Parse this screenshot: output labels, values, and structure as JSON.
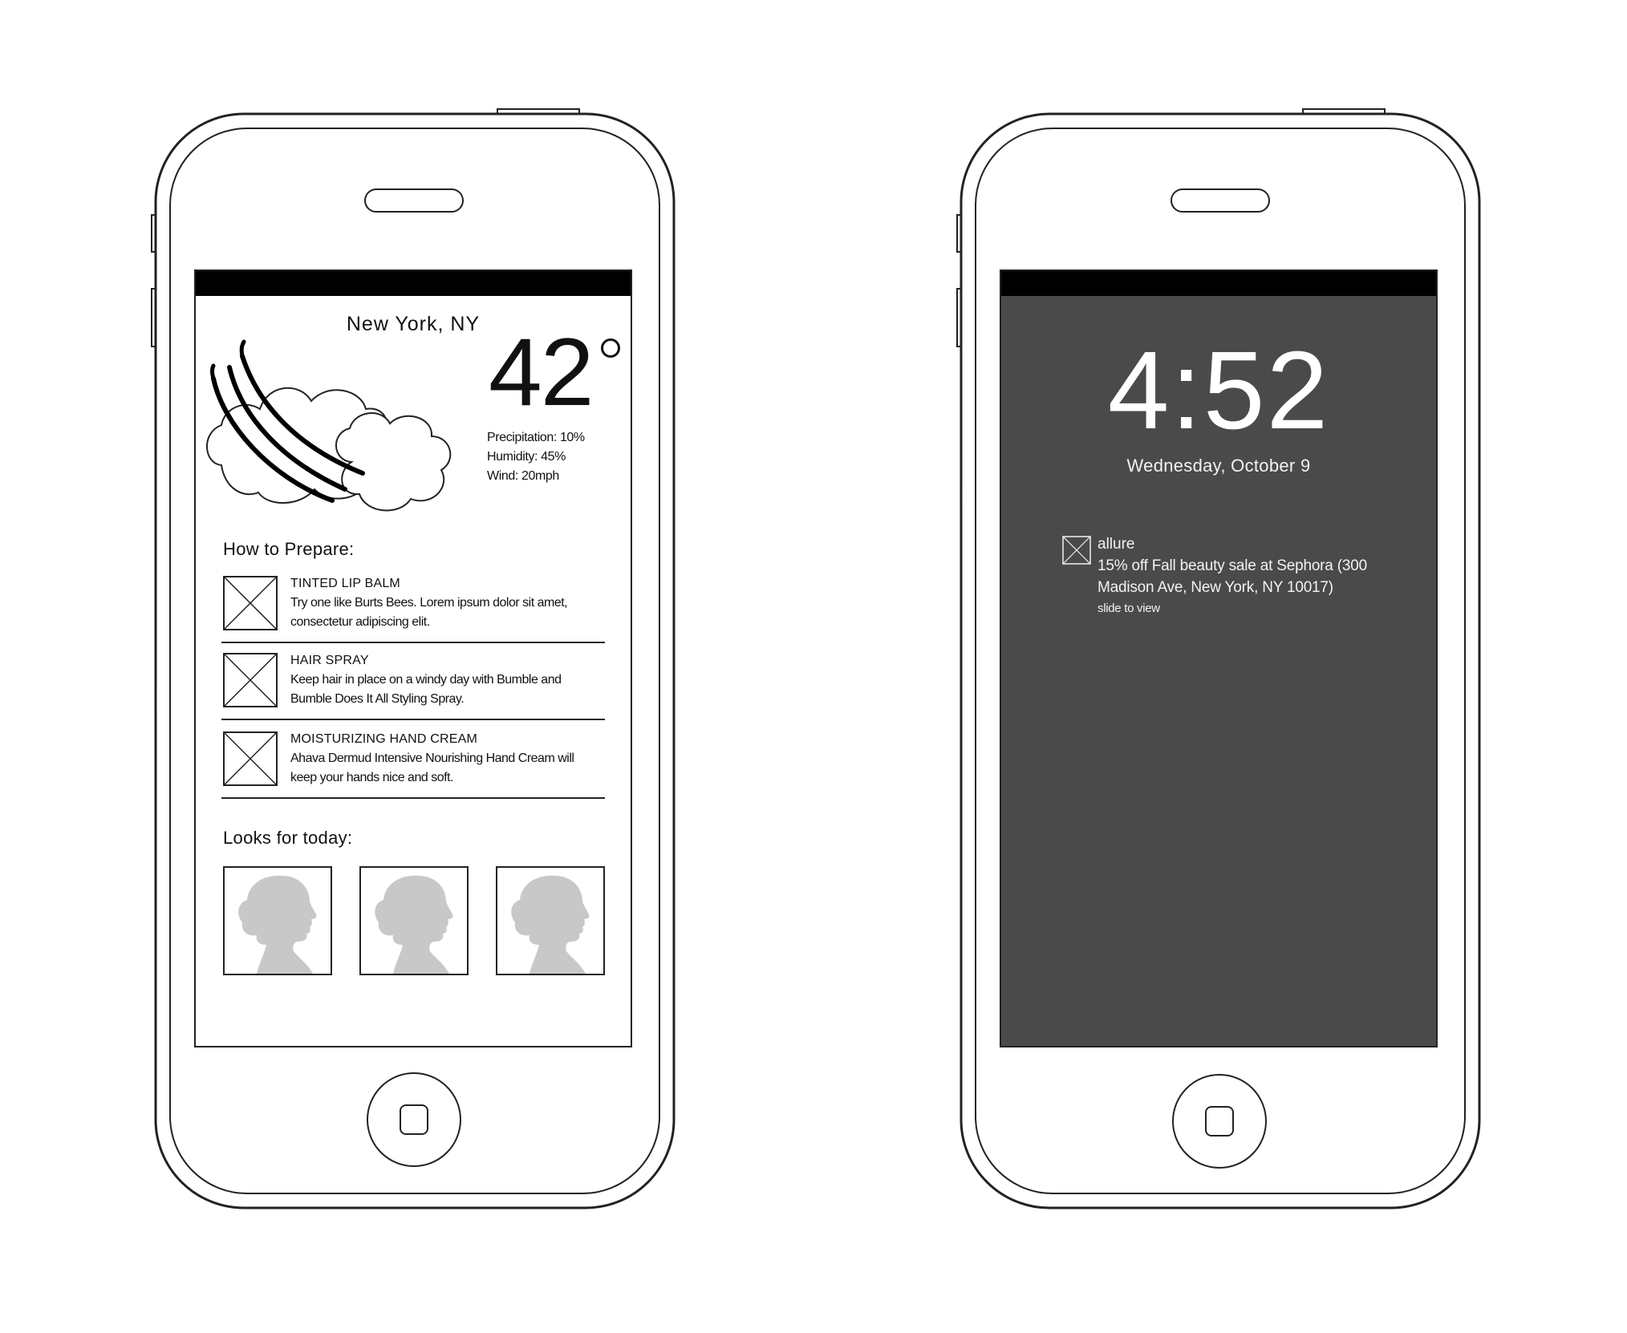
{
  "weather_screen": {
    "location": "New York, NY",
    "temperature": "42",
    "stats": {
      "precipitation": "Precipitation: 10%",
      "humidity": "Humidity: 45%",
      "wind": "Wind: 20mph"
    },
    "icons": {
      "weather": "wind-cloud-icon",
      "placeholder": "image-placeholder-icon",
      "look": "silhouette-icon"
    },
    "prepare": {
      "title": "How to Prepare:",
      "items": [
        {
          "name": "TINTED LIP BALM",
          "description": "Try one like Burts Bees. Lorem ipsum dolor sit amet, consectetur adipiscing elit."
        },
        {
          "name": "HAIR SPRAY",
          "description": "Keep hair in place on a windy day with Bumble and Bumble Does It All Styling Spray."
        },
        {
          "name": "MOISTURIZING HAND CREAM",
          "description": "Ahava Dermud Intensive Nourishing Hand Cream will keep your hands nice and soft."
        }
      ]
    },
    "looks": {
      "title": "Looks for today:",
      "count_label": ""
    }
  },
  "lock_screen": {
    "time": "4:52",
    "date": "Wednesday, October 9",
    "notification": {
      "app": "allure",
      "message": "15% off Fall beauty sale at Sephora (300 Madison Ave, New York, NY 10017)",
      "hint": "slide to view"
    }
  },
  "colors": {
    "status_bar": "#000000",
    "lock_background": "#4a4a4a",
    "silhouette": "#c8c8c8",
    "outline": "#222222"
  }
}
